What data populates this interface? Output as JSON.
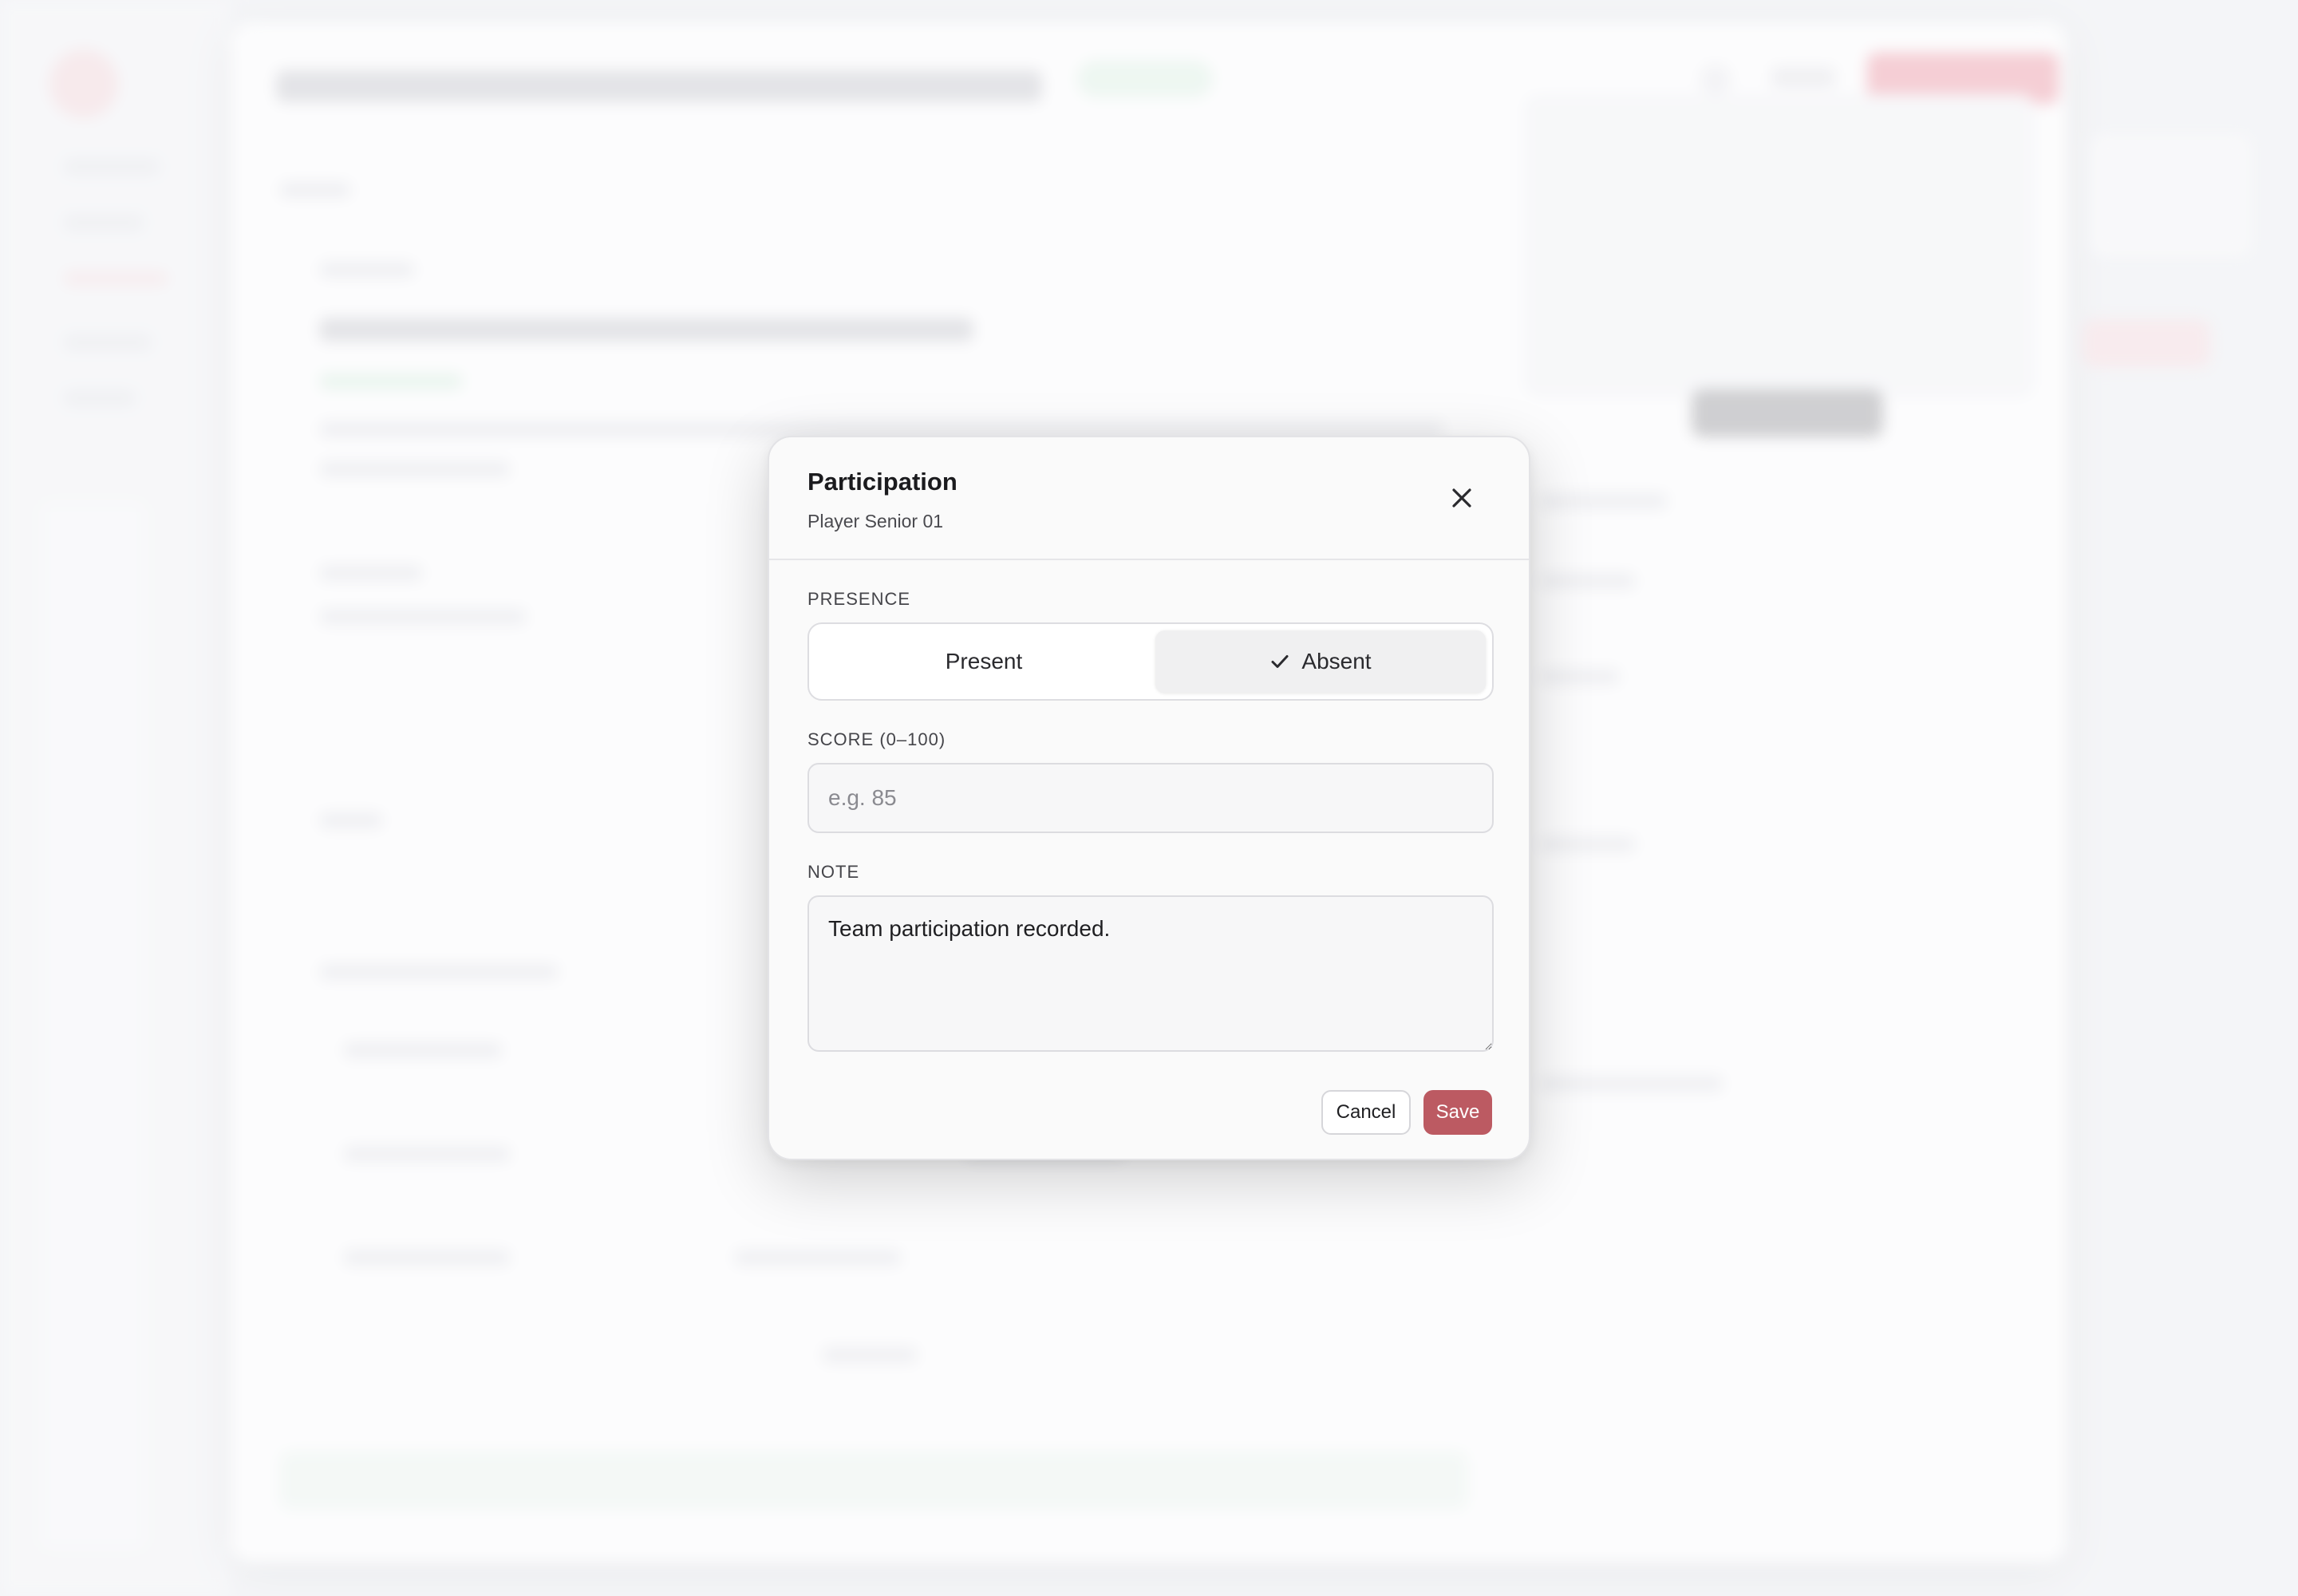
{
  "modal": {
    "title": "Participation",
    "subtitle": "Player Senior 01",
    "close_icon": "close-icon",
    "presence": {
      "label": "PRESENCE",
      "options": [
        {
          "label": "Present",
          "selected": false
        },
        {
          "label": "Absent",
          "selected": true,
          "icon": "check-icon"
        }
      ]
    },
    "score": {
      "label": "SCORE (0–100)",
      "placeholder": "e.g. 85",
      "value": ""
    },
    "note": {
      "label": "NOTE",
      "value": "Team participation recorded."
    },
    "actions": {
      "cancel_label": "Cancel",
      "save_label": "Save"
    }
  },
  "colors": {
    "accent": "#bc5a62",
    "modal_background": "#fafafa",
    "selected_segment": "#f0f0f1"
  }
}
